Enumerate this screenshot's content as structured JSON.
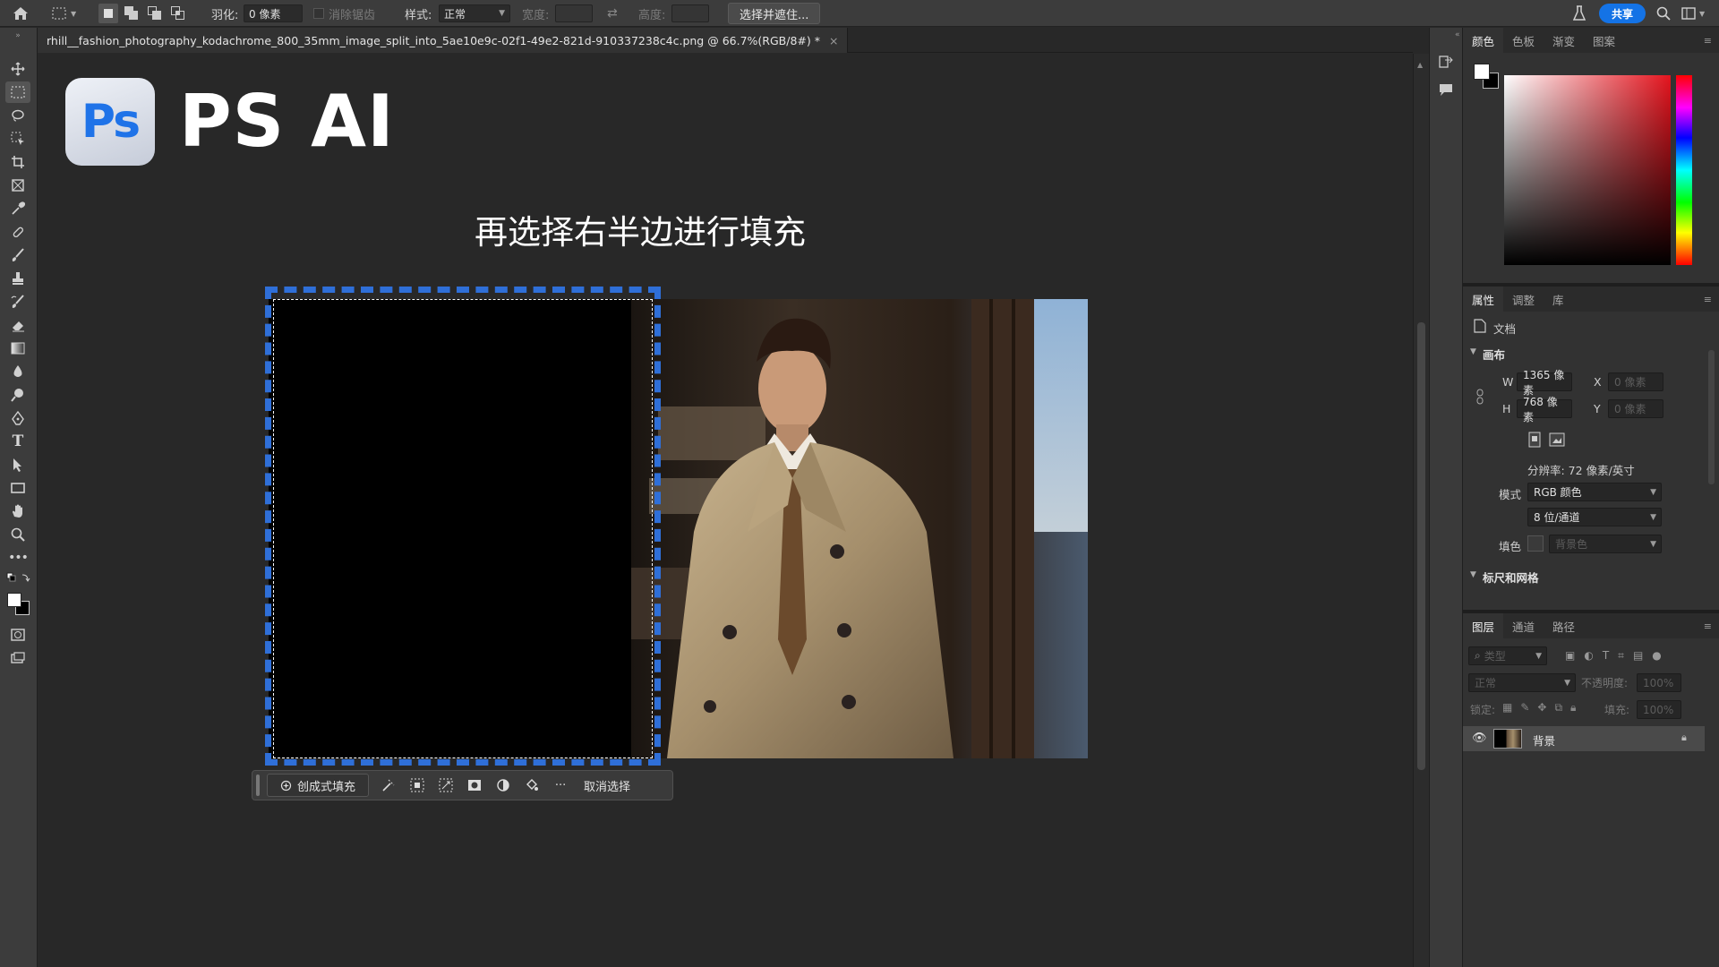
{
  "options_bar": {
    "feather_label": "羽化:",
    "feather_value": "0 像素",
    "antialias_label": "消除锯齿",
    "style_label": "样式:",
    "style_value": "正常",
    "width_label": "宽度:",
    "height_label": "高度:",
    "select_mask_button": "选择并遮住...",
    "share_button": "共享"
  },
  "document_tab": {
    "title": "rhill__fashion_photography_kodachrome_800_35mm_image_split_into_5ae10e9c-02f1-49e2-821d-910337238c4c.png @ 66.7%(RGB/8#) *",
    "close": "×"
  },
  "canvas": {
    "logo_text": "Ps",
    "brand_title": "PS AI",
    "caption": "再选择右半边进行填充"
  },
  "task_bar": {
    "generative_fill": "创成式填充",
    "deselect": "取消选择",
    "more": "···"
  },
  "color_panel": {
    "tabs": [
      "颜色",
      "色板",
      "渐变",
      "图案"
    ]
  },
  "properties_panel": {
    "tabs": [
      "属性",
      "调整",
      "库"
    ],
    "doc_label": "文档",
    "canvas_section": "画布",
    "w_label": "W",
    "w_value": "1365 像素",
    "h_label": "H",
    "h_value": "768 像素",
    "x_label": "X",
    "x_value": "0 像素",
    "y_label": "Y",
    "y_value": "0 像素",
    "resolution": "分辨率: 72 像素/英寸",
    "mode_label": "模式",
    "mode_value": "RGB 颜色",
    "depth_value": "8 位/通道",
    "fill_label": "填色",
    "fill_value": "背景色",
    "rulers_section": "标尺和网格"
  },
  "layers_panel": {
    "tabs": [
      "图层",
      "通道",
      "路径"
    ],
    "search_placeholder": "类型",
    "blend_mode": "正常",
    "opacity_label": "不透明度:",
    "opacity_value": "100%",
    "lock_label": "锁定:",
    "fill_label": "填充:",
    "fill_value": "100%",
    "layer_name": "背景"
  },
  "colors": {
    "accent": "#1473e6",
    "selection_border": "#2f6fd8",
    "app_bg": "#282828"
  }
}
